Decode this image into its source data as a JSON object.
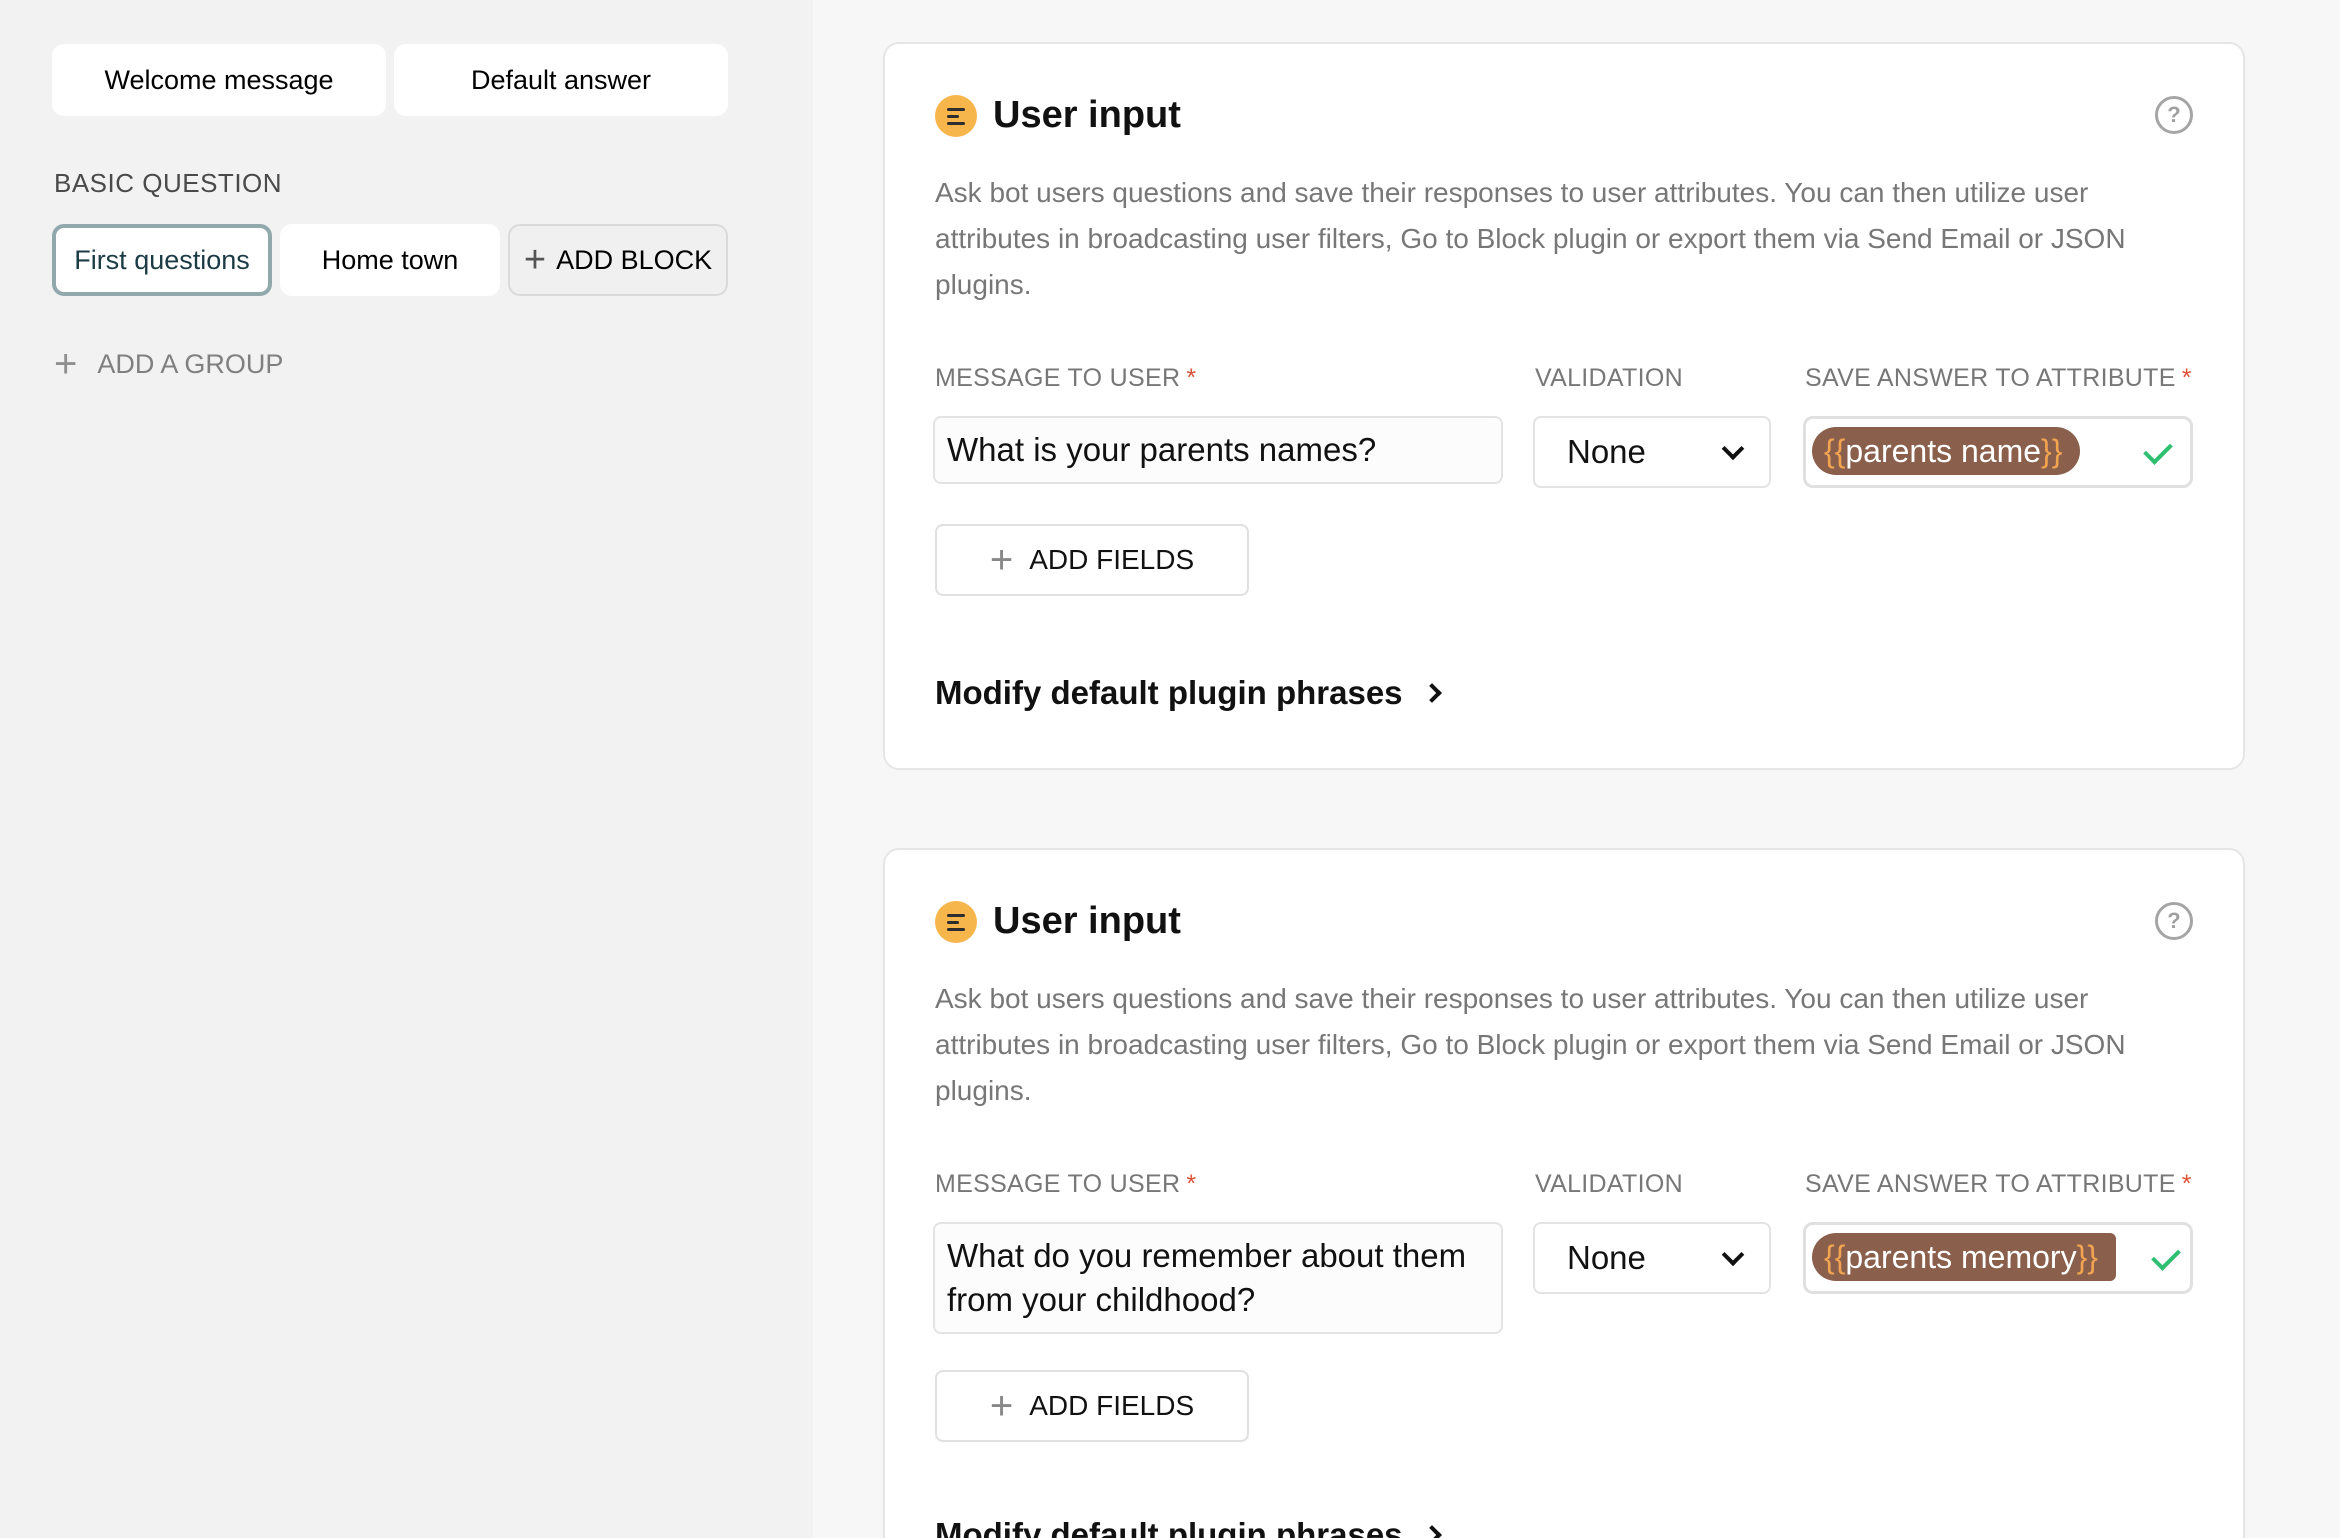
{
  "sidebar": {
    "top_buttons": [
      "Welcome message",
      "Default answer"
    ],
    "section_title": "BASIC QUESTION",
    "blocks": [
      "First questions",
      "Home town"
    ],
    "add_block_label": "ADD BLOCK",
    "add_group_label": "ADD A GROUP"
  },
  "cards": [
    {
      "title": "User input",
      "description": "Ask bot users questions and save their responses to user attributes. You can then utilize user attributes in broadcasting user filters, Go to Block plugin or export them via Send Email or JSON plugins.",
      "message_label": "MESSAGE TO USER",
      "required_mark": "*",
      "message_value": "What is your parents names?",
      "validation_label": "VALIDATION",
      "validation_value": "None",
      "attribute_label": "SAVE ANSWER TO ATTRIBUTE",
      "brace_open": "{{",
      "attribute_value": "parents name",
      "brace_close": "}}",
      "add_fields_label": "ADD FIELDS",
      "modify_label": "Modify default plugin phrases"
    },
    {
      "title": "User input",
      "description": "Ask bot users questions and save their responses to user attributes. You can then utilize user attributes in broadcasting user filters, Go to Block plugin or export them via Send Email or JSON plugins.",
      "message_label": "MESSAGE TO USER",
      "required_mark": "*",
      "message_value": "What do you remember about them from your childhood?",
      "validation_label": "VALIDATION",
      "validation_value": "None",
      "attribute_label": "SAVE ANSWER TO ATTRIBUTE",
      "brace_open": "{{",
      "attribute_value": "parents memory",
      "brace_close": "}}",
      "add_fields_label": "ADD FIELDS",
      "modify_label": "Modify default plugin phrases"
    }
  ],
  "icons": {
    "plugin": "user-input-icon",
    "help": "help-icon",
    "add": "plus-icon",
    "dropdown": "chevron-down-icon",
    "valid": "check-icon",
    "expand": "chevron-right-icon"
  },
  "colors": {
    "plugin_icon": "#f7b64b",
    "attribute_chip": "#8a5f4b",
    "attribute_brace": "#f2a451",
    "check": "#2fbf71",
    "required": "#e0533a",
    "selected_border": "#91a9ad"
  }
}
